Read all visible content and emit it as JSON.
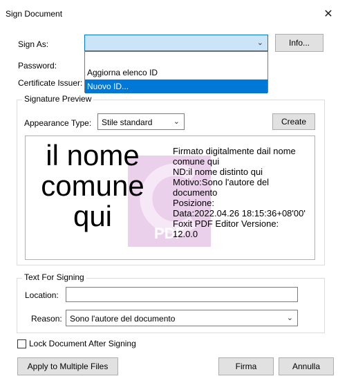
{
  "window": {
    "title": "Sign Document",
    "close_glyph": "✕"
  },
  "sign_as": {
    "label": "Sign As:",
    "value": "",
    "info_button": "Info..."
  },
  "dropdown": {
    "items": [
      "Aggiorna elenco ID",
      "Nuovo ID..."
    ],
    "selected_index": 1
  },
  "password": {
    "label": "Password:"
  },
  "certificate_issuer": {
    "label": "Certificate Issuer:"
  },
  "signature_preview": {
    "group_title": "Signature Preview",
    "appearance_label": "Appearance Type:",
    "appearance_value": "Stile standard",
    "create_button": "Create",
    "name_lines": [
      "il nome",
      "comune",
      "qui"
    ],
    "details_lines": [
      "Firmato digitalmente dail nome",
      "comune qui",
      "ND:il nome distinto qui",
      "Motivo:Sono l'autore del",
      "documento",
      "Posizione:",
      "Data:2022.04.26 18:15:36+08'00'",
      "Foxit PDF Editor Versione:",
      "12.0.0"
    ],
    "watermark_text": "PDF"
  },
  "text_for_signing": {
    "group_title": "Text For Signing",
    "location_label": "Location:",
    "location_value": "",
    "reason_label": "Reason:",
    "reason_value": "Sono l'autore del documento"
  },
  "lock_document": {
    "label": "Lock Document After Signing",
    "checked": false
  },
  "buttons": {
    "apply_multiple": "Apply to Multiple Files",
    "sign": "Firma",
    "cancel": "Annulla"
  },
  "colors": {
    "accent": "#0078d7",
    "combo_focus_bg": "#cce4f7",
    "button_bg": "#e1e1e1",
    "watermark": "#e8c6e8"
  },
  "icons": {
    "dropdown_arrow": "chevron-down-icon",
    "close": "close-icon",
    "watermark": "foxit-watermark-icon"
  }
}
